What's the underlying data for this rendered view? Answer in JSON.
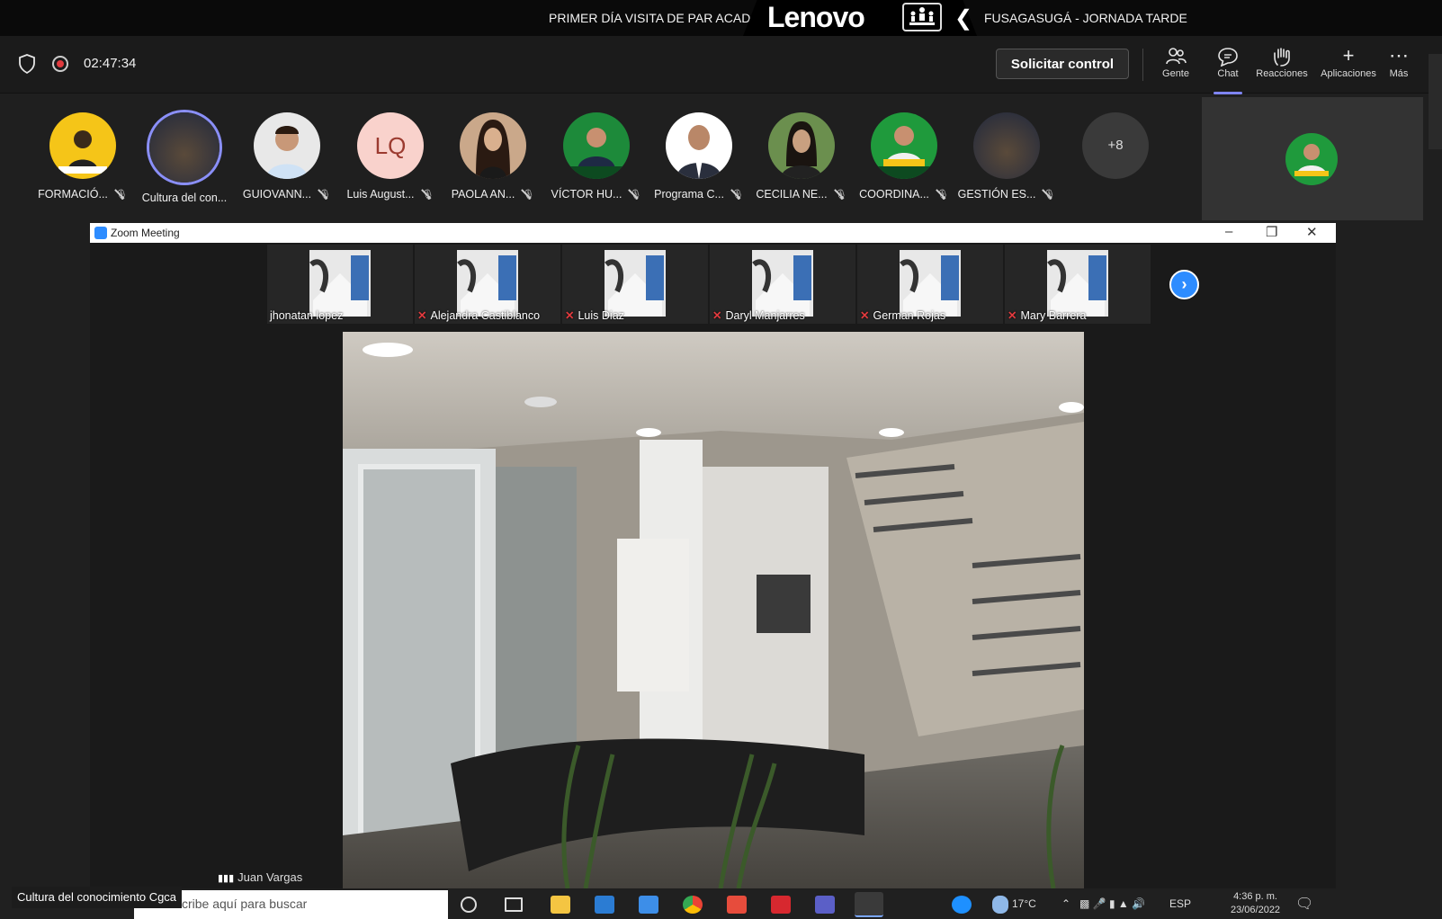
{
  "title_bar": {
    "text_left": "PRIMER DÍA VISITA DE PAR ACAD",
    "brand": "Lenovo",
    "text_right": "FUSAGASUGÁ - JORNADA TARDE"
  },
  "header": {
    "timer": "02:47:34",
    "control_button": "Solicitar control",
    "items": [
      {
        "label": "Gente",
        "icon": "people-icon"
      },
      {
        "label": "Chat",
        "icon": "chat-icon"
      },
      {
        "label": "Reacciones",
        "icon": "raise-hand-icon"
      },
      {
        "label": "Aplicaciones",
        "icon": "plus-icon"
      },
      {
        "label": "Más",
        "icon": "more-icon"
      }
    ]
  },
  "participants": [
    {
      "name": "FORMACIÓ...",
      "initials": "",
      "bg": "#f5c518"
    },
    {
      "name": "Cultura del con...",
      "initials": "",
      "bg": "#2b3550"
    },
    {
      "name": "GUIOVANN...",
      "initials": "",
      "bg": "#e8e8e8"
    },
    {
      "name": "Luis August...",
      "initials": "LQ",
      "bg": "#f9d2cc"
    },
    {
      "name": "PAOLA AN...",
      "initials": "",
      "bg": "#caa88a"
    },
    {
      "name": "VÍCTOR HU...",
      "initials": "",
      "bg": "#1d8a3a"
    },
    {
      "name": "Programa C...",
      "initials": "",
      "bg": "#ffffff"
    },
    {
      "name": "CECILIA NE...",
      "initials": "",
      "bg": "#6b8f4e"
    },
    {
      "name": "COORDINA...",
      "initials": "",
      "bg": "#1f9a3c"
    },
    {
      "name": "GESTIÓN ES...",
      "initials": "",
      "bg": "#2b3550"
    }
  ],
  "more_participants": "+8",
  "zoom": {
    "window_title": "Zoom Meeting",
    "thumbnails": [
      {
        "name": "jhonatan lopez",
        "muted": false
      },
      {
        "name": "Alejandra Castiblanco",
        "muted": true
      },
      {
        "name": "Luis Diaz",
        "muted": true
      },
      {
        "name": "Daryl Manjarres",
        "muted": true
      },
      {
        "name": "German Rojas",
        "muted": true
      },
      {
        "name": "Mary Barrera",
        "muted": true
      }
    ],
    "active_speaker": "Juan Vargas"
  },
  "taskbar": {
    "window_label": "Cultura del conocimiento Cgca",
    "search_placeholder": "scribe aquí para buscar",
    "temperature": "17°C",
    "language": "ESP",
    "time": "4:36 p. m.",
    "date": "23/06/2022"
  },
  "colors": {
    "accent": "#7f85f5",
    "record": "#e03a3e",
    "zoom_blue": "#2d8cff"
  }
}
